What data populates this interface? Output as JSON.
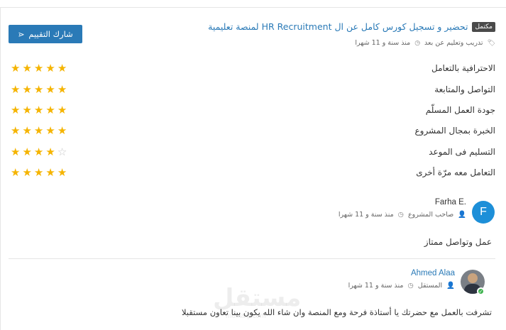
{
  "header": {
    "share_label": "شارك التقييم",
    "badge": "مكتمل",
    "title": "تحضير و تسجيل كورس كامل عن ال HR Recruitment لمنصة تعليمية",
    "category": "تدريب وتعليم عن بعد",
    "time": "منذ سنة و 11 شهرا"
  },
  "ratings": [
    {
      "label": "الاحترافية بالتعامل",
      "stars": 5
    },
    {
      "label": "التواصل والمتابعة",
      "stars": 5
    },
    {
      "label": "جودة العمل المسلّم",
      "stars": 5
    },
    {
      "label": "الخبرة بمجال المشروع",
      "stars": 5
    },
    {
      "label": "التسليم فى الموعد",
      "stars": 4
    },
    {
      "label": "التعامل معه مرّة أخرى",
      "stars": 5
    }
  ],
  "review1": {
    "avatar_letter": "F",
    "name": "Farha E.",
    "role": "صاحب المشروع",
    "time": "منذ سنة و 11 شهرا",
    "text": "عمل وتواصل ممتاز"
  },
  "review2": {
    "name": "Ahmed Alaa",
    "role": "المستقل",
    "time": "منذ سنة و 11 شهرا",
    "text": "تشرفت بالعمل مع حضرتك يا أستاذة فرحة ومع المنصة وان شاء الله يكون بينا تعاون مستقبلا"
  },
  "watermark": {
    "text": "مستقل",
    "sub": "mostaql.com"
  },
  "colors": {
    "accent": "#2a7ab7",
    "star": "#f5b400",
    "online": "#3fb34f"
  }
}
